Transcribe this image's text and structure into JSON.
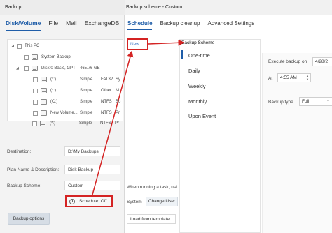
{
  "back_window": {
    "title": "Backup",
    "tabs": [
      "Disk/Volume",
      "File",
      "Mail",
      "ExchangeDB"
    ],
    "tree": {
      "root_label": "This PC",
      "system_backup_label": "System Backup",
      "disk_label": "Disk 0 Basic, GPT",
      "disk_size": "465.76 GB",
      "partitions": [
        {
          "name": "(*:)",
          "type": "Simple",
          "fs": "FAT32",
          "extra": "Sy"
        },
        {
          "name": "(*:)",
          "type": "Simple",
          "fs": "Other",
          "extra": "M"
        },
        {
          "name": "(C:)",
          "type": "Simple",
          "fs": "NTFS",
          "extra": "Bo"
        },
        {
          "name": "New Volume...",
          "type": "Simple",
          "fs": "NTFS",
          "extra": "Pr"
        },
        {
          "name": "(*:)",
          "type": "Simple",
          "fs": "NTFS",
          "extra": "Pr"
        }
      ]
    },
    "form": {
      "destination_label": "Destination:",
      "destination_value": "D:\\My Backups",
      "plan_label": "Plan Name & Description:",
      "plan_value": "Disk Backup",
      "scheme_label": "Backup Scheme:",
      "scheme_value": "Custom"
    },
    "schedule_button": "Schedule: Off",
    "backup_options_button": "Backup options"
  },
  "front_window": {
    "title": "Backup scheme - Custom",
    "tabs": [
      "Schedule",
      "Backup cleanup",
      "Advanced Settings"
    ],
    "new_button": "New...",
    "panel_title": "Backup Scheme",
    "frequencies": [
      "One-time",
      "Daily",
      "Weekly",
      "Monthly",
      "Upon Event"
    ],
    "execute_label": "Execute backup on",
    "execute_date": "4/28/2",
    "at_label": "At",
    "at_value": "4:55 AM",
    "backup_type_label": "Backup type",
    "backup_type_value": "Full",
    "task_text": "When running a task, usi",
    "system_label": "System",
    "change_user_button": "Change User",
    "load_template_button": "Load from template"
  },
  "colors": {
    "accent": "#1f5da8",
    "highlight": "#d42323"
  }
}
